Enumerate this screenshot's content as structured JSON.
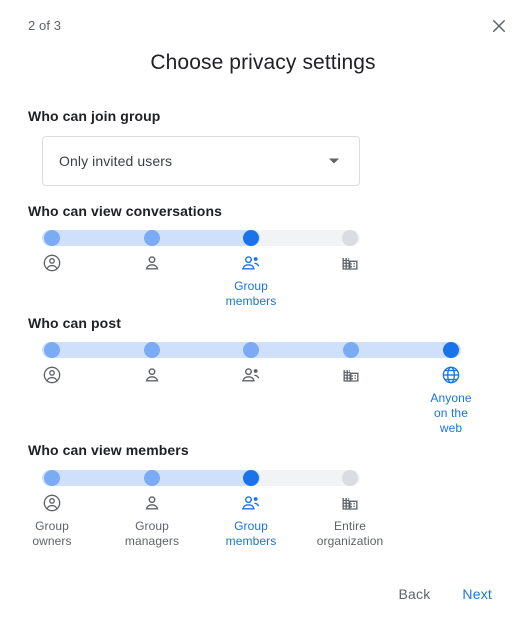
{
  "header": {
    "step_counter": "2 of 3",
    "title": "Choose privacy settings",
    "close_icon": "close-icon"
  },
  "sections": {
    "join_group": {
      "label": "Who can join group",
      "select_value": "Only invited users",
      "select_arrow_icon": "chevron-down-icon"
    },
    "view_conversations": {
      "label": "Who can view conversations",
      "selected_index": 2,
      "stops": [
        {
          "icon": "account-circle-icon",
          "label": ""
        },
        {
          "icon": "person-icon",
          "label": ""
        },
        {
          "icon": "group-icon",
          "label": "Group members"
        },
        {
          "icon": "domain-icon",
          "label": ""
        }
      ]
    },
    "post": {
      "label": "Who can post",
      "selected_index": 4,
      "stops": [
        {
          "icon": "account-circle-icon",
          "label": ""
        },
        {
          "icon": "person-icon",
          "label": ""
        },
        {
          "icon": "group-icon",
          "label": ""
        },
        {
          "icon": "domain-icon",
          "label": ""
        },
        {
          "icon": "globe-icon",
          "label": "Anyone on the web"
        }
      ]
    },
    "view_members": {
      "label": "Who can view members",
      "selected_index": 2,
      "stops": [
        {
          "icon": "account-circle-icon",
          "label": "Group owners"
        },
        {
          "icon": "person-icon",
          "label": "Group managers"
        },
        {
          "icon": "group-icon",
          "label": "Group members"
        },
        {
          "icon": "domain-icon",
          "label": "Entire organization"
        }
      ]
    }
  },
  "footer": {
    "back_label": "Back",
    "next_label": "Next"
  },
  "colors": {
    "accent": "#1a73e8",
    "dot_filled": "#7cabf5",
    "dot_empty": "#dadce0",
    "track": "#f1f3f4",
    "fill": "#cfe0fc",
    "text_primary": "#202124",
    "text_secondary": "#5f6368"
  }
}
